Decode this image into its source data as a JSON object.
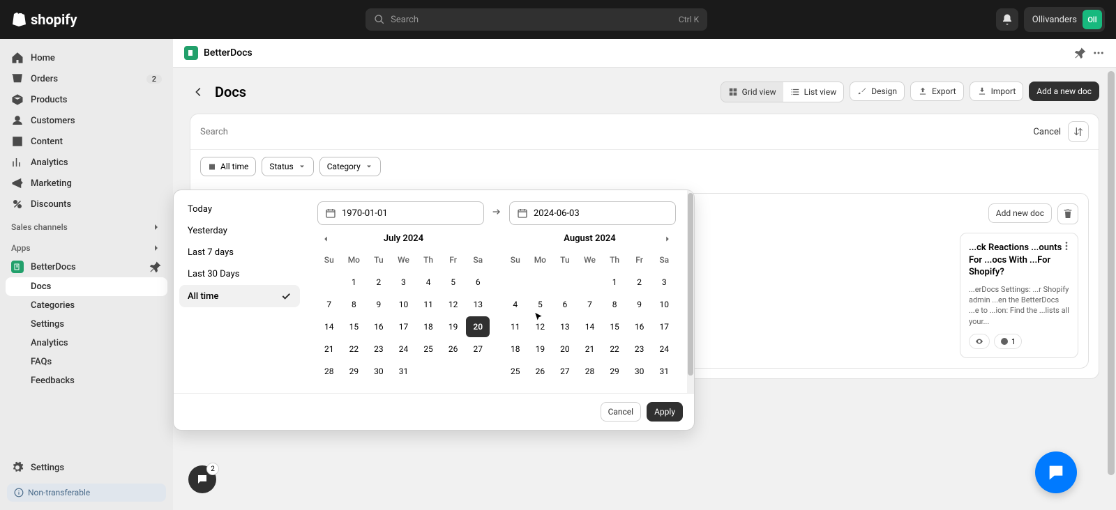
{
  "topbar": {
    "brand": "shopify",
    "search_placeholder": "Search",
    "search_kbd": "Ctrl K",
    "user_name": "Ollivanders",
    "user_initials": "Oll"
  },
  "sidebar": {
    "nav": [
      {
        "label": "Home",
        "icon": "home"
      },
      {
        "label": "Orders",
        "icon": "orders",
        "badge": "2"
      },
      {
        "label": "Products",
        "icon": "products"
      },
      {
        "label": "Customers",
        "icon": "customers"
      },
      {
        "label": "Content",
        "icon": "content"
      },
      {
        "label": "Analytics",
        "icon": "analytics"
      },
      {
        "label": "Marketing",
        "icon": "marketing"
      },
      {
        "label": "Discounts",
        "icon": "discounts"
      }
    ],
    "sales_channels_label": "Sales channels",
    "apps_label": "Apps",
    "app_name": "BetterDocs",
    "app_children": [
      {
        "label": "Docs",
        "active": true
      },
      {
        "label": "Categories"
      },
      {
        "label": "Settings"
      },
      {
        "label": "Analytics"
      },
      {
        "label": "FAQs"
      },
      {
        "label": "Feedbacks"
      }
    ],
    "settings_label": "Settings",
    "non_transferable": "Non-transferable"
  },
  "app_header": {
    "title": "BetterDocs"
  },
  "page": {
    "title": "Docs",
    "toolbar": {
      "grid_view": "Grid view",
      "list_view": "List view",
      "design": "Design",
      "export": "Export",
      "import": "Import",
      "add_doc": "Add a new doc"
    },
    "search_placeholder": "Search",
    "cancel": "Cancel",
    "filters": {
      "all_time": "All time",
      "status": "Status",
      "category": "Category"
    },
    "category_card": {
      "add_new": "Add new doc"
    },
    "doc_card": {
      "title": "...ck Reactions ...ounts For ...ocs With ...For Shopify?",
      "body": "...erDocs Settings: ...r Shopify admin ...en the BetterDocs ...e to ...ion: Find the ...lists all your...",
      "reaction_count": "1"
    }
  },
  "picker": {
    "presets": [
      "Today",
      "Yesterday",
      "Last 7 days",
      "Last 30 Days",
      "All time"
    ],
    "active_preset": "All time",
    "from": "1970-01-01",
    "to": "2024-06-03",
    "month1": {
      "label": "July 2024",
      "first_dow": 1,
      "days": 31,
      "today": 20
    },
    "month2": {
      "label": "August 2024",
      "first_dow": 4,
      "days": 31
    },
    "dows": [
      "Su",
      "Mo",
      "Tu",
      "We",
      "Th",
      "Fr",
      "Sa"
    ],
    "cancel": "Cancel",
    "apply": "Apply"
  },
  "chat_badge": "2"
}
